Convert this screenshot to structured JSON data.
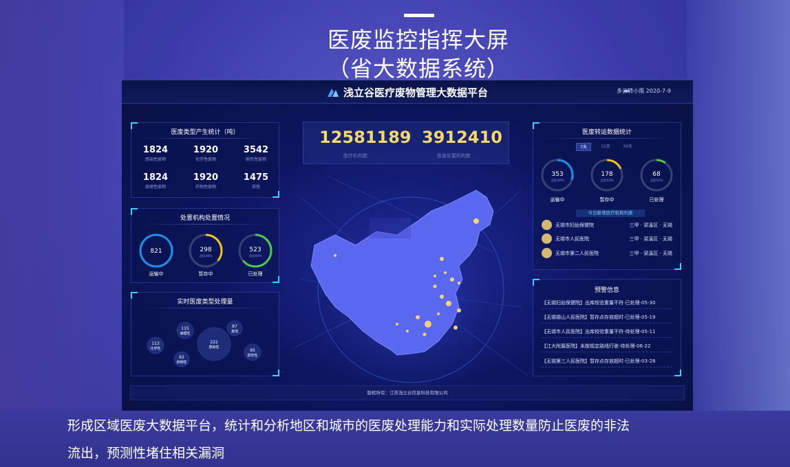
{
  "slide": {
    "title_line1": "医废监控指挥大屏",
    "title_line2": "（省大数据系统）",
    "caption_line1": "形成区域医废大数据平台，统计和分析地区和城市的医废处理能力和实际处理数量防止医废的非法",
    "caption_line2": "流出，预测性堵住相关漏洞"
  },
  "header": {
    "platform_title": "浅立谷医疗废物管理大数据平台",
    "weather": "多云转小雨  2020-7-9",
    "weather_icon": "cloud-icon"
  },
  "waste_types": {
    "title": "医废类型产生统计（吨）",
    "items": [
      {
        "value": "1824",
        "label": "感染性废物"
      },
      {
        "value": "1920",
        "label": "化学性废物"
      },
      {
        "value": "3542",
        "label": "损伤性废物"
      },
      {
        "value": "1824",
        "label": "病理性废物"
      },
      {
        "value": "1920",
        "label": "药物性废物"
      },
      {
        "value": "1475",
        "label": "其他"
      }
    ]
  },
  "disposal": {
    "title": "处置机构处置情况",
    "rings": [
      {
        "value": "821",
        "sub": "",
        "label": "运输中",
        "color": "#1e8fe8",
        "fraction": 1.0
      },
      {
        "value": "298",
        "sub": "占比36%",
        "label": "暂存中",
        "color": "#f2c21b",
        "fraction": 0.36
      },
      {
        "value": "523",
        "sub": "占比64%",
        "label": "已处理",
        "color": "#4fc84c",
        "fraction": 0.64
      }
    ]
  },
  "realtime": {
    "title": "实时医废类型处理量",
    "bubbles": [
      {
        "value": "115",
        "label": "病理性"
      },
      {
        "value": "87",
        "label": "其他"
      },
      {
        "value": "222",
        "label": "感染性"
      },
      {
        "value": "113",
        "label": "化学性"
      },
      {
        "value": "92",
        "label": "药物性"
      },
      {
        "value": "95",
        "label": "损伤性"
      }
    ]
  },
  "center": {
    "num1": "12581189",
    "num1_label": "医疗机构数",
    "num2": "3912410",
    "num2_label": "医废处置机构数"
  },
  "transfer": {
    "title": "医废转运数据统计",
    "tabs": [
      "7天",
      "15天",
      "30天"
    ],
    "active_tab": "7天",
    "rings": [
      {
        "value": "353",
        "sub": "占比30%",
        "label": "运输中",
        "color": "#1e8fe8",
        "fraction": 0.3
      },
      {
        "value": "178",
        "sub": "占比52%",
        "label": "暂存中",
        "color": "#f2c21b",
        "fraction": 0.18
      },
      {
        "value": "68",
        "sub": "占比52%",
        "label": "已处理",
        "color": "#4fc84c",
        "fraction": 0.1
      }
    ],
    "list_title": "今日新增医疗机构列表",
    "orgs": [
      {
        "name": "无锡市妇幼保健院",
        "meta": "三甲 · 梁溪区 · 无锡"
      },
      {
        "name": "无锡市人民医院",
        "meta": "三甲 · 梁溪区 · 无锡"
      },
      {
        "name": "无锡市第二人民医院",
        "meta": "三甲 · 梁溪区 · 无锡"
      }
    ]
  },
  "alerts": {
    "title": "预警信息",
    "items": [
      "【无锡妇幼保健院】出库校验重量不符-已处理-05-30",
      "【无锡锡山人民医院】暂存点存放超时-已处理-05-19",
      "【无锡市人民医院】出库校验重量不符-待处理-05-11",
      "【江大附属医院】未按规定路线行驶-待处理-06-22",
      "【无锡第三人民医院】暂存点存放超时-已处理-03-28"
    ]
  },
  "footer": {
    "copyright": "版权所有：江苏浅立谷信息科技有限公司"
  }
}
